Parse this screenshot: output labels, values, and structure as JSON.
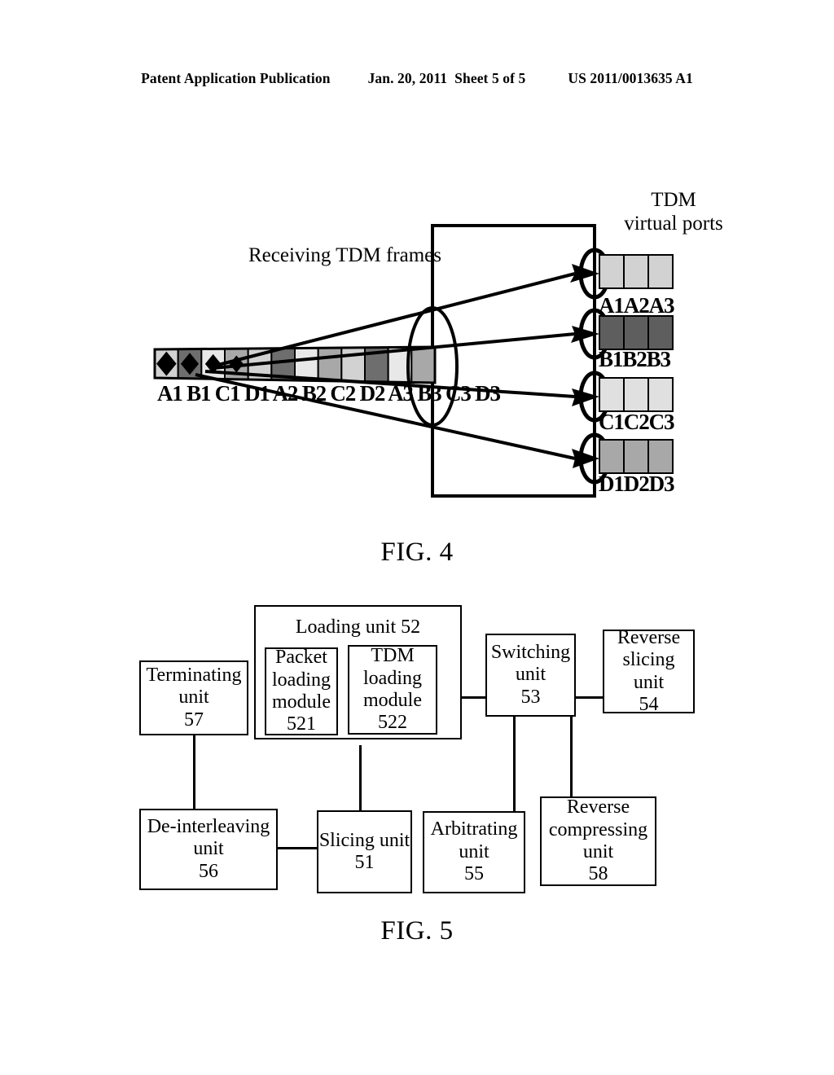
{
  "header": {
    "publication": "Patent Application Publication",
    "date": "Jan. 20, 2011",
    "sheet": "Sheet 5 of 5",
    "number": "US 2011/0013635 A1"
  },
  "figures": [
    {
      "id": "fig4",
      "caption": "FIG. 4",
      "labels": {
        "virtual_ports_line1": "TDM",
        "virtual_ports_line2": "virtual ports",
        "receiving": "Receiving TDM frames",
        "strip_cells": "A1 B1 C1 D1 A2 B2 C2 D2 A3 B3 C3 D3"
      },
      "strip": {
        "cell_labels": [
          "A1",
          "B1",
          "C1",
          "D1",
          "A2",
          "B2",
          "C2",
          "D2",
          "A3",
          "B3",
          "C3",
          "D3"
        ],
        "cell_shades": [
          "#d2d2d2",
          "#6e6e6e",
          "#e8e8e8",
          "#a8a8a8",
          "#d2d2d2",
          "#6e6e6e",
          "#e8e8e8",
          "#a8a8a8",
          "#d2d2d2",
          "#6e6e6e",
          "#e8e8e8",
          "#a8a8a8"
        ],
        "marker_count": 4,
        "marker_shape": "diamond"
      },
      "virtual_ports": [
        {
          "name": "port-a",
          "label": "A1A2A3",
          "shade": "#d2d2d2",
          "cells": 3
        },
        {
          "name": "port-b",
          "label": "B1B2B3",
          "shade": "#5e5e5e",
          "cells": 3
        },
        {
          "name": "port-c",
          "label": "C1C2C3",
          "shade": "#e0e0e0",
          "cells": 3
        },
        {
          "name": "port-d",
          "label": "D1D2D3",
          "shade": "#a8a8a8",
          "cells": 3
        }
      ],
      "arrow_count": 4
    },
    {
      "id": "fig5",
      "caption": "FIG. 5",
      "group": {
        "name": "loading-unit",
        "title": "Loading unit 52",
        "modules": [
          {
            "name": "packet-loading-module",
            "lines": [
              "Packet",
              "loading",
              "module",
              "521"
            ]
          },
          {
            "name": "tdm-loading-module",
            "lines": [
              "TDM",
              "loading",
              "module",
              "522"
            ]
          }
        ]
      },
      "nodes": [
        {
          "name": "terminating-unit",
          "lines": [
            "Terminating",
            "unit",
            "57"
          ]
        },
        {
          "name": "switching-unit",
          "lines": [
            "Switching",
            "unit",
            "53"
          ]
        },
        {
          "name": "reverse-slicing-unit",
          "lines": [
            "Reverse",
            "slicing",
            "unit",
            "54"
          ]
        },
        {
          "name": "de-interleaving-unit",
          "lines": [
            "De-interleaving",
            "unit",
            "56"
          ]
        },
        {
          "name": "slicing-unit",
          "lines": [
            "Slicing unit",
            "51"
          ]
        },
        {
          "name": "arbitrating-unit",
          "lines": [
            "Arbitrating",
            "unit",
            "55"
          ]
        },
        {
          "name": "reverse-compressing-unit",
          "lines": [
            "Reverse",
            "compressing",
            "unit",
            "58"
          ]
        }
      ]
    }
  ]
}
